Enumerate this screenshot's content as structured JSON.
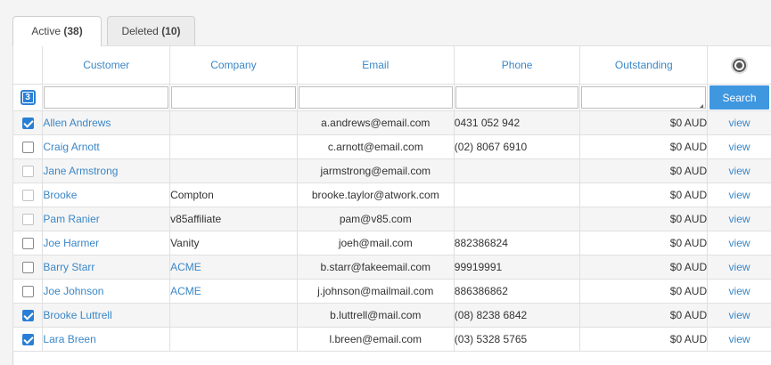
{
  "tabs": [
    {
      "label": "Active",
      "count": "(38)",
      "active": true
    },
    {
      "label": "Deleted",
      "count": "(10)",
      "active": false
    }
  ],
  "columns": [
    "Customer",
    "Company",
    "Email",
    "Phone",
    "Outstanding"
  ],
  "selected_count": "3",
  "search_label": "Search",
  "settings_icon": "gear-icon",
  "accent_color": "#3a87c8",
  "rows": [
    {
      "checked": true,
      "enabled": true,
      "customer": "Allen Andrews",
      "company": "",
      "company_link": false,
      "email": "a.andrews@email.com",
      "phone": "0431 052 942",
      "outstanding": "$0 AUD",
      "action": "view"
    },
    {
      "checked": false,
      "enabled": true,
      "customer": "Craig Arnott",
      "company": "",
      "company_link": false,
      "email": "c.arnott@email.com",
      "phone": "(02) 8067 6910",
      "outstanding": "$0 AUD",
      "action": "view"
    },
    {
      "checked": false,
      "enabled": false,
      "customer": "Jane Armstrong",
      "company": "",
      "company_link": false,
      "email": "jarmstrong@email.com",
      "phone": "",
      "outstanding": "$0 AUD",
      "action": "view"
    },
    {
      "checked": false,
      "enabled": false,
      "customer": "Brooke",
      "company": "Compton",
      "company_link": false,
      "email": "brooke.taylor@atwork.com",
      "phone": "",
      "outstanding": "$0 AUD",
      "action": "view"
    },
    {
      "checked": false,
      "enabled": false,
      "customer": "Pam Ranier",
      "company": "v85affiliate",
      "company_link": false,
      "email": "pam@v85.com",
      "phone": "",
      "outstanding": "$0 AUD",
      "action": "view"
    },
    {
      "checked": false,
      "enabled": true,
      "customer": "Joe Harmer",
      "company": "Vanity",
      "company_link": false,
      "email": "joeh@mail.com",
      "phone": "882386824",
      "outstanding": "$0 AUD",
      "action": "view"
    },
    {
      "checked": false,
      "enabled": true,
      "customer": "Barry Starr",
      "company": "ACME",
      "company_link": true,
      "email": "b.starr@fakeemail.com",
      "phone": "99919991",
      "outstanding": "$0 AUD",
      "action": "view"
    },
    {
      "checked": false,
      "enabled": true,
      "customer": "Joe Johnson",
      "company": "ACME",
      "company_link": true,
      "email": "j.johnson@mailmail.com",
      "phone": "886386862",
      "outstanding": "$0 AUD",
      "action": "view"
    },
    {
      "checked": true,
      "enabled": true,
      "customer": "Brooke Luttrell",
      "company": "",
      "company_link": false,
      "email": "b.luttrell@mail.com",
      "phone": "(08) 8238 6842",
      "outstanding": "$0 AUD",
      "action": "view"
    },
    {
      "checked": true,
      "enabled": true,
      "customer": "Lara Breen",
      "company": "",
      "company_link": false,
      "email": "l.breen@email.com",
      "phone": "(03) 5328 5765",
      "outstanding": "$0 AUD",
      "action": "view"
    }
  ]
}
